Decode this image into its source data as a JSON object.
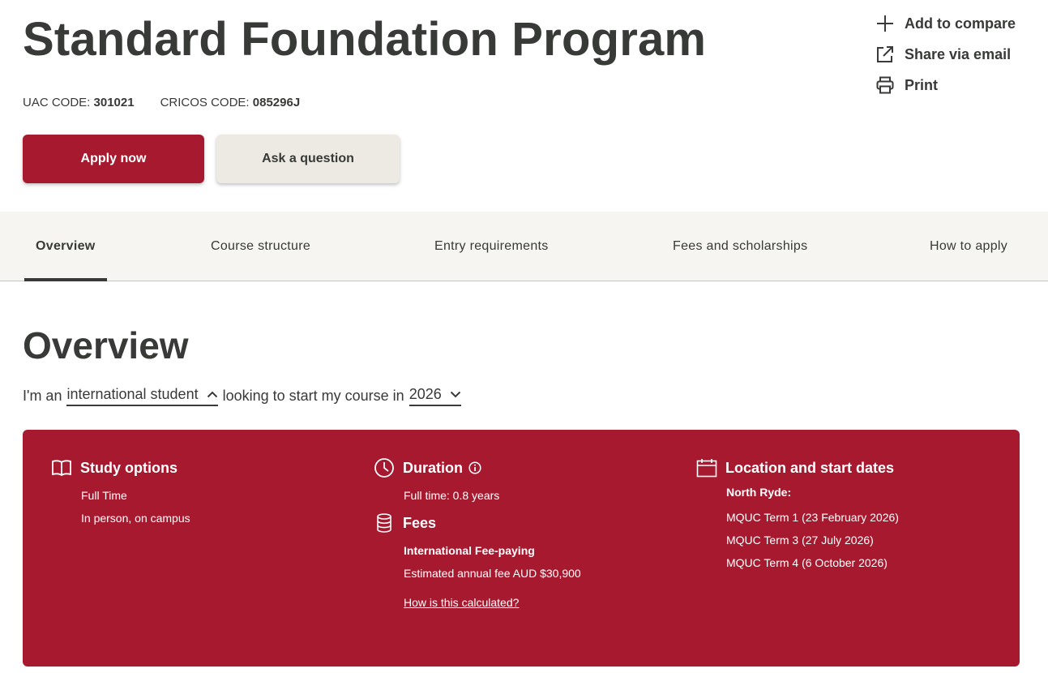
{
  "header": {
    "title": "Standard Foundation Program",
    "uac_label": "UAC CODE:",
    "uac_value": "301021",
    "cricos_label": "CRICOS CODE:",
    "cricos_value": "085296J"
  },
  "actions": {
    "compare": "Add to compare",
    "share": "Share via email",
    "print": "Print"
  },
  "buttons": {
    "apply": "Apply now",
    "ask": "Ask a question"
  },
  "tabs": [
    {
      "label": "Overview",
      "active": true
    },
    {
      "label": "Course structure"
    },
    {
      "label": "Entry requirements"
    },
    {
      "label": "Fees and scholarships"
    },
    {
      "label": "How to apply"
    }
  ],
  "overview": {
    "heading": "Overview",
    "prefix": "I'm an",
    "student_type": "international student",
    "middle": "looking to start my course in",
    "year": "2026"
  },
  "panel": {
    "study": {
      "heading": "Study options",
      "items": [
        "Full Time",
        "In person, on campus"
      ]
    },
    "duration": {
      "heading": "Duration",
      "value": "Full time: 0.8 years"
    },
    "fees": {
      "heading": "Fees",
      "type": "International Fee-paying",
      "estimate": "Estimated annual fee AUD $30,900",
      "link": "How is this calculated?"
    },
    "location": {
      "heading": "Location and start dates",
      "campus": "North Ryde:",
      "dates": [
        "MQUC Term 1 (23 February 2026)",
        "MQUC Term 3 (27 July 2026)",
        "MQUC Term 4 (6 October 2026)"
      ]
    }
  },
  "colors": {
    "brand": "#a6192e",
    "text": "#373a36",
    "secondary_button": "#edeae4",
    "tabbar": "#f6f5f2"
  }
}
